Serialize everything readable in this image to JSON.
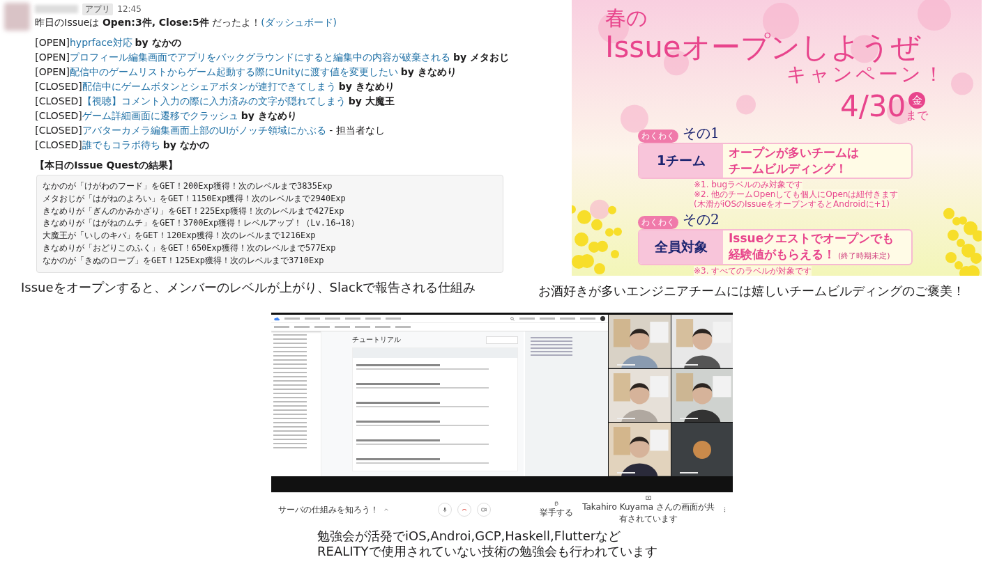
{
  "slack": {
    "app_badge": "アプリ",
    "time": "12:45",
    "summary": "昨日のIssueは **Open:3件, Close:5件** だったよ！",
    "summary_link": "(ダッシュボード)",
    "issues": [
      {
        "status": "[OPEN]",
        "title": "hyprface対応",
        "owner": "by なかの",
        "owner_bold": true
      },
      {
        "status": "[OPEN]",
        "title": "プロフィール編集画面でアプリをバックグラウンドにすると編集中の内容が破棄される",
        "owner": "by メタおじ",
        "owner_bold": true
      },
      {
        "status": "[OPEN]",
        "title": "配信中のゲームリストからゲーム起動する際にUnityに渡す値を変更したい",
        "owner": "by きなめり",
        "owner_bold": true
      },
      {
        "status": "[CLOSED]",
        "title": "配信中にゲームボタンとシェアボタンが連打できてしまう",
        "owner": "by きなめり",
        "owner_bold": true
      },
      {
        "status": "[CLOSED]",
        "title": "【視聴】コメント入力の際に入力済みの文字が隠れてしまう",
        "owner": "by 大魔王",
        "owner_bold": true
      },
      {
        "status": "[CLOSED]",
        "title": "ゲーム詳細画面に遷移でクラッシュ",
        "owner": "by きなめり",
        "owner_bold": true
      },
      {
        "status": "[CLOSED]",
        "title": "アバターカメラ編集画面上部のUIがノッチ領域にかぶる",
        "owner": "- 担当者なし",
        "owner_bold": false
      },
      {
        "status": "[CLOSED]",
        "title": "誰でもコラボ待ち",
        "owner": "by なかの",
        "owner_bold": true
      }
    ],
    "quest_heading": "【本日のIssue Questの結果】",
    "quest_lines": [
      "なかのが「けがわのフード」をGET！200Exp獲得！次のレベルまで3835Exp",
      "メタおじが「はがねのよろい」をGET！1150Exp獲得！次のレベルまで2940Exp",
      "きなめりが「ぎんのかみかざり」をGET！225Exp獲得！次のレベルまで427Exp",
      "きなめりが「はがねのムチ」をGET！3700Exp獲得！レベルアップ！（Lv.16→18）",
      "大魔王が「いしのキバ」をGET！120Exp獲得！次のレベルまで1216Exp",
      "きなめりが「おどりこのふく」をGET！650Exp獲得！次のレベルまで577Exp",
      "なかのが「きぬのローブ」をGET！125Exp獲得！次のレベルまで3710Exp"
    ],
    "caption": "Issueをオープンすると、メンバーのレベルが上がり、Slackで報告される仕組み"
  },
  "poster": {
    "title_top": "春の",
    "title_main": "Issueオープンしようぜ",
    "title_sub": "キャンペーン！",
    "date": "4/30",
    "weekday": "金",
    "until": "まで",
    "sections": [
      {
        "tag": "わくわく",
        "number": "その1",
        "target": "1チーム",
        "message": [
          "オープンが多いチームは",
          "チームビルディング！"
        ],
        "notes": [
          "※1. bugラベルのみ対象です",
          "※2. 他のチームOpenしても個人にOpenは紐付きます",
          "(木滑がiOSのIssueをオープンするとAndroidに+1)"
        ]
      },
      {
        "tag": "わくわく",
        "number": "その2",
        "target": "全員対象",
        "message": [
          "Issueクエストでオープンでも",
          "経験値がもらえる！"
        ],
        "aside": "(終了時期未定)",
        "notes": [
          "※3. すべてのラベルが対象です"
        ]
      }
    ],
    "caption": "お酒好きが多いエンジニアチームには嬉しいチームビルディングのご褒美！"
  },
  "meet": {
    "browser": {
      "heading": "チュートリアル"
    },
    "tiles": [
      {
        "kind": "picture"
      },
      {
        "kind": "picture"
      },
      {
        "kind": "picture"
      },
      {
        "kind": "picture"
      },
      {
        "kind": "picture"
      },
      {
        "kind": "avatar"
      }
    ],
    "meeting_title": "サーバの仕組みを知ろう！",
    "raise_hand": "挙手する",
    "presenting": "Takahiro Kuyama さんの画面が共有されています",
    "caption": [
      "勉強会が活発でiOS,Androi,GCP,Haskell,Flutterなど",
      "REALITYで使用されていない技術の勉強会も行われています"
    ]
  }
}
